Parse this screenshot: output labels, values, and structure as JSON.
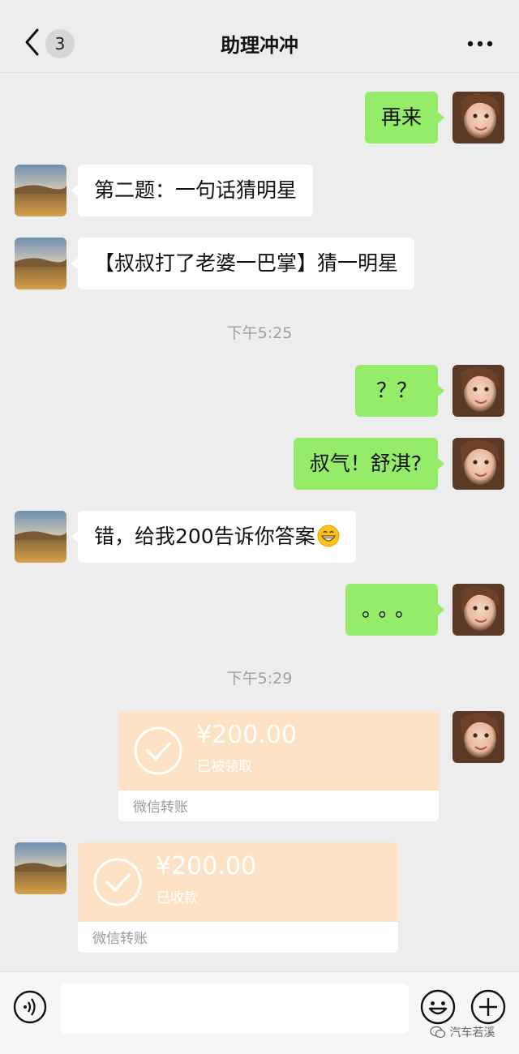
{
  "header": {
    "back_badge": "3",
    "title": "助理冲冲"
  },
  "messages": {
    "m1": "再来",
    "m2": "第二题：一句话猜明星",
    "m3": "【叔叔打了老婆一巴掌】猜一明星",
    "t1": "下午5:25",
    "m4": "？？",
    "m5": "叔气！舒淇?",
    "m6": "错，给我200告诉你答案",
    "m6_emoji": "grinning-face-icon",
    "m7": "。。。",
    "t2": "下午5:29"
  },
  "transfers": [
    {
      "amount": "¥200.00",
      "status": "已被领取",
      "footer": "微信转账"
    },
    {
      "amount": "¥200.00",
      "status": "已收款",
      "footer": "微信转账"
    }
  ],
  "input_bar": {
    "watermark": "汽车若溪"
  },
  "colors": {
    "background": "#ededed",
    "green_bubble": "#95ec69",
    "transfer": "#fde2c6"
  },
  "icons": [
    "chevron-left-icon",
    "more-dots-icon",
    "voice-icon",
    "emoji-icon",
    "plus-icon",
    "check-circle-icon"
  ]
}
